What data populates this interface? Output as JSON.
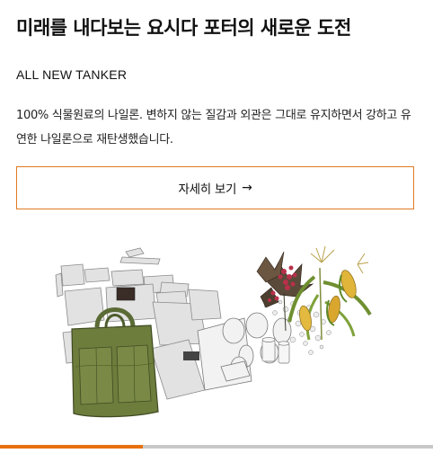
{
  "headline": "미래를 내다보는 요시다 포터의 새로운 도전",
  "subhead": "ALL NEW TANKER",
  "body": "100% 식물원료의 나일론. 변하지 않는 질감과 외관은 그대로 유지하면서 강하고 유연한 나일론으로 재탄생했습니다.",
  "detail_button": {
    "label": "자세히 보기",
    "arrow": "→"
  },
  "illustration": {
    "description_icon": "tanker-bag-plant-nylon-illustration"
  },
  "carousel": {
    "progress": 0.33
  },
  "colors": {
    "accent": "#e8700f",
    "button_border": "#e07a22",
    "track": "#c8c8c8"
  }
}
